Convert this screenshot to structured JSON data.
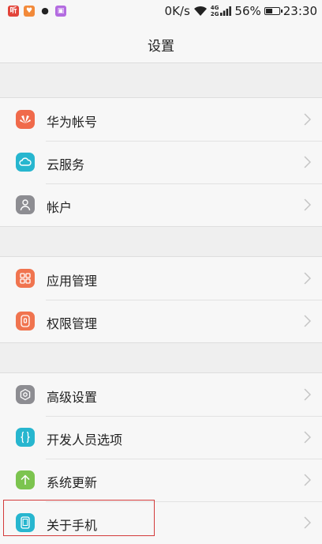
{
  "status_bar": {
    "notif_icons": [
      "music-app-icon",
      "heart-app-icon",
      "qq-penguin-icon",
      "photo-app-icon"
    ],
    "speed": "0K/s",
    "network_4g": "4G",
    "network_2g": "2G",
    "battery_percent": "56%",
    "battery_level": 0.56,
    "time": "23:30"
  },
  "header": {
    "title": "设置"
  },
  "sections": [
    {
      "items": [
        {
          "label": "华为帐号",
          "icon": "huawei-logo-icon",
          "color": "#f06a4b"
        },
        {
          "label": "云服务",
          "icon": "cloud-icon",
          "color": "#27b6cf"
        },
        {
          "label": "帐户",
          "icon": "user-icon",
          "color": "#8d8d92"
        }
      ]
    },
    {
      "items": [
        {
          "label": "应用管理",
          "icon": "app-grid-icon",
          "color": "#f0744f"
        },
        {
          "label": "权限管理",
          "icon": "permission-icon",
          "color": "#f0744f"
        }
      ]
    },
    {
      "items": [
        {
          "label": "高级设置",
          "icon": "gear-icon",
          "color": "#8d8d92"
        },
        {
          "label": "开发人员选项",
          "icon": "braces-icon",
          "color": "#27b6cf"
        },
        {
          "label": "系统更新",
          "icon": "update-arrow-icon",
          "color": "#7cc44f"
        },
        {
          "label": "关于手机",
          "icon": "phone-icon",
          "color": "#27b6cf"
        }
      ]
    }
  ],
  "colors": {
    "highlight_border": "#d33b3b",
    "background": "#efefef",
    "row_background": "#f7f7f7"
  }
}
